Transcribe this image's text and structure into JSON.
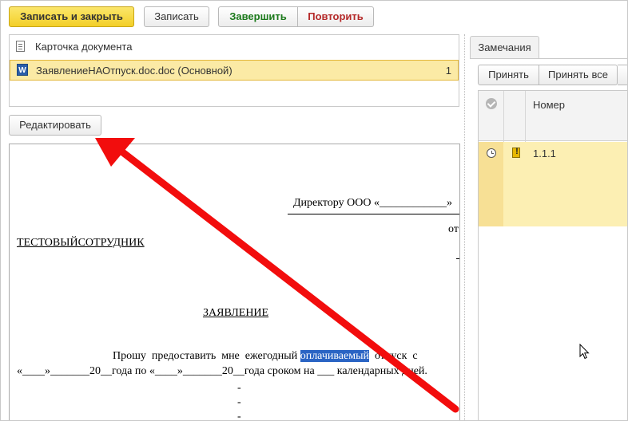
{
  "toolbar": {
    "save_close": "Записать и закрыть",
    "save": "Записать",
    "finish": "Завершить",
    "repeat": "Повторить"
  },
  "attachments": {
    "card_label": "Карточка документа",
    "file_label": "ЗаявлениеНАОтпуск.doc.doc (Основной)",
    "file_count": "1"
  },
  "edit_button": "Редактировать",
  "document": {
    "to_director": "Директору ООО «____________»",
    "from_short": "от",
    "employee": "ТЕСТОВЫЙСОТРУДНИК",
    "title": "ЗАЯВЛЕНИЕ",
    "body_start": "Прошу  предоставить  мне  ежегодный",
    "body_highlight": "оплачиваемый",
    "body_end": "  отпуск  с",
    "body_line2": "«____»_______20__года по «____»_______20__года сроком  на ___ календарных дней.",
    "dash": "-"
  },
  "remarks": {
    "tab_label": "Замечания",
    "accept": "Принять",
    "accept_all": "Принять все",
    "col_number": "Номер",
    "rows": [
      {
        "number": "1.1.1"
      }
    ]
  },
  "icons": {
    "card": "document-icon",
    "file": "word-icon",
    "status": "clock-icon",
    "priority": "warning-icon",
    "check_header": "check-circle-icon",
    "cursor": "mouse-cursor-icon"
  },
  "colors": {
    "primary_button": "#f3cf28",
    "selection": "#fbeaa5",
    "finish_text": "#1c7a1c",
    "repeat_text": "#b52a2a",
    "annotation_arrow": "#f20d0d",
    "text_highlight": "#2a64c4"
  }
}
